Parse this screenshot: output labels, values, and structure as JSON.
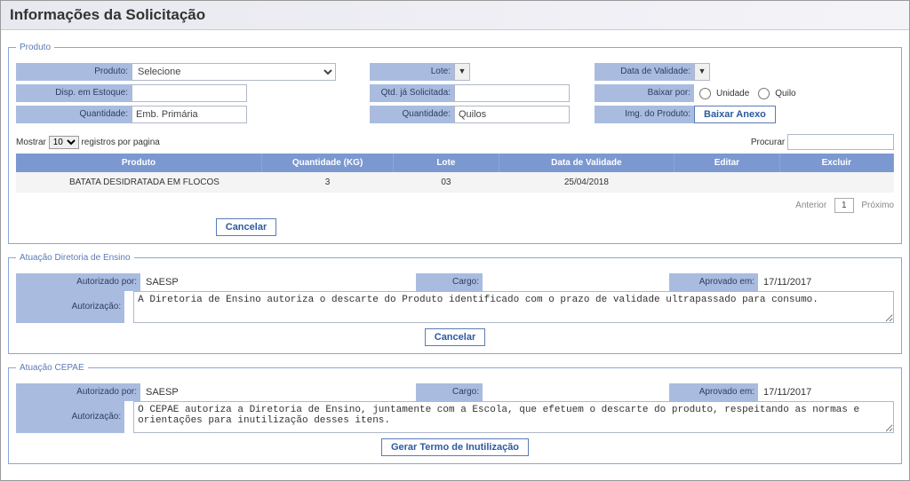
{
  "page": {
    "title": "Informações da Solicitação"
  },
  "fieldsets": {
    "produto_legend": "Produto",
    "atuacao_de_legend": "Atuação Diretoria de Ensino",
    "atuacao_cepae_legend": "Atuação CEPAE"
  },
  "produto": {
    "labels": {
      "produto": "Produto:",
      "lote": "Lote:",
      "data_validade": "Data de Validade:",
      "disp_estoque": "Disp. em Estoque:",
      "qtd_ja_solicitada": "Qtd. já Solicitada:",
      "baixar_por": "Baixar por:",
      "quantidade": "Quantidade:",
      "quantidade2": "Quantidade:",
      "img_produto": "Img. do Produto:"
    },
    "values": {
      "produto_selected": "Selecione",
      "disp_estoque": "",
      "qtd_ja_solicitada": "",
      "quantidade": "Emb. Primária",
      "quantidade2": "Quilos"
    },
    "radios": {
      "unidade": "Unidade",
      "quilo": "Quilo"
    },
    "buttons": {
      "baixar_anexo": "Baixar Anexo",
      "cancelar": "Cancelar"
    }
  },
  "datatable": {
    "length_prefix": "Mostrar",
    "length_value": "10",
    "length_suffix": "registros por pagina",
    "search_label": "Procurar",
    "columns": [
      "Produto",
      "Quantidade (KG)",
      "Lote",
      "Data de Validade",
      "Editar",
      "Excluir"
    ],
    "rows": [
      {
        "produto": "BATATA DESIDRATADA EM FLOCOS",
        "quantidade": "3",
        "lote": "03",
        "validade": "25/04/2018",
        "editar": "",
        "excluir": ""
      }
    ],
    "paging": {
      "prev": "Anterior",
      "next": "Próximo",
      "current": "1"
    }
  },
  "atuacao_de": {
    "labels": {
      "autorizado_por": "Autorizado por:",
      "cargo": "Cargo:",
      "aprovado_em": "Aprovado em:",
      "autorizacao": "Autorização:"
    },
    "values": {
      "autorizado_por": "SAESP",
      "cargo": "",
      "aprovado_em": "17/11/2017",
      "autorizacao": "A Diretoria de Ensino autoriza o descarte do Produto identificado com o prazo de validade ultrapassado para consumo."
    },
    "buttons": {
      "cancelar": "Cancelar"
    }
  },
  "atuacao_cepae": {
    "labels": {
      "autorizado_por": "Autorizado por:",
      "cargo": "Cargo:",
      "aprovado_em": "Aprovado em:",
      "autorizacao": "Autorização:"
    },
    "values": {
      "autorizado_por": "SAESP",
      "cargo": "",
      "aprovado_em": "17/11/2017",
      "autorizacao": "O CEPAE autoriza a Diretoria de Ensino, juntamente com a Escola, que efetuem o descarte do produto, respeitando as normas e orientações para inutilização desses itens."
    },
    "buttons": {
      "gerar_termo": "Gerar Termo de Inutilização"
    }
  }
}
